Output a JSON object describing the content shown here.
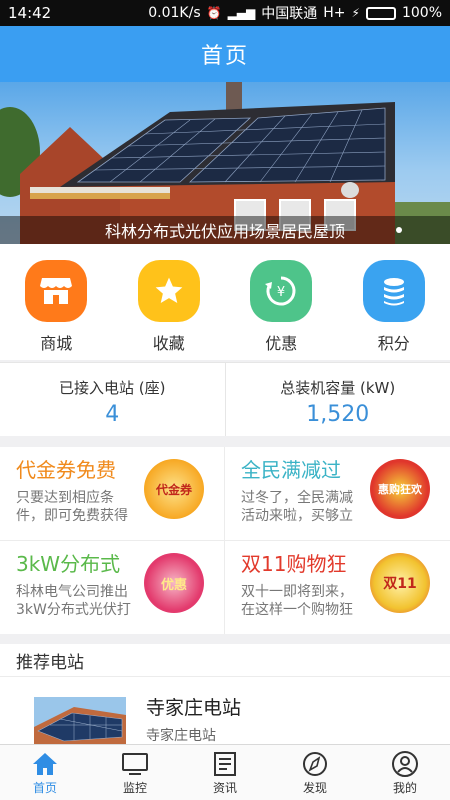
{
  "status_bar": {
    "time": "14:42",
    "speed": "0.01K/s",
    "carrier": "中国联通",
    "network": "H+",
    "battery": "100%",
    "battery_level": 1.0
  },
  "header": {
    "title": "首页"
  },
  "banner": {
    "caption": "科林分布式光伏应用场景居民屋顶"
  },
  "quick_menu": [
    {
      "label": "商城",
      "icon": "store-icon",
      "color": "#ff7a1a"
    },
    {
      "label": "收藏",
      "icon": "star-icon",
      "color": "#ffc21a"
    },
    {
      "label": "优惠",
      "icon": "coupon-icon",
      "color": "#4ec48a"
    },
    {
      "label": "积分",
      "icon": "points-icon",
      "color": "#3aa3f0"
    }
  ],
  "stats": [
    {
      "label": "已接入电站 (座)",
      "value": "4"
    },
    {
      "label": "总装机容量 (kW)",
      "value": "1,520"
    }
  ],
  "promos": [
    {
      "title": "代金券免费",
      "desc": "只要达到相应条件，即可免费获得",
      "color": "#f08a1c",
      "badge": "代金券",
      "badge_color": "#f7a823"
    },
    {
      "title": "全民满减过",
      "desc": "过冬了，全民满减活动来啦，买够立",
      "color": "#3bb3c6",
      "badge": "惠购狂欢",
      "badge_color": "#e0362c"
    },
    {
      "title": "3kW分布式",
      "desc": "科林电气公司推出3kW分布式光伏打",
      "color": "#5ab94a",
      "badge": "优惠",
      "badge_color": "#e33a6d"
    },
    {
      "title": "双11购物狂",
      "desc": "双十一即将到来，在这样一个购物狂",
      "color": "#e23a2c",
      "badge": "双11",
      "badge_color": "#f2c330"
    }
  ],
  "recommended": {
    "header": "推荐电站",
    "items": [
      {
        "name": "寺家庄电站",
        "subtitle": "寺家庄电站"
      }
    ]
  },
  "tabs": [
    {
      "label": "首页",
      "icon": "home-icon",
      "active": true
    },
    {
      "label": "监控",
      "icon": "monitor-icon",
      "active": false
    },
    {
      "label": "资讯",
      "icon": "news-icon",
      "active": false
    },
    {
      "label": "发现",
      "icon": "compass-icon",
      "active": false
    },
    {
      "label": "我的",
      "icon": "profile-icon",
      "active": false
    }
  ]
}
